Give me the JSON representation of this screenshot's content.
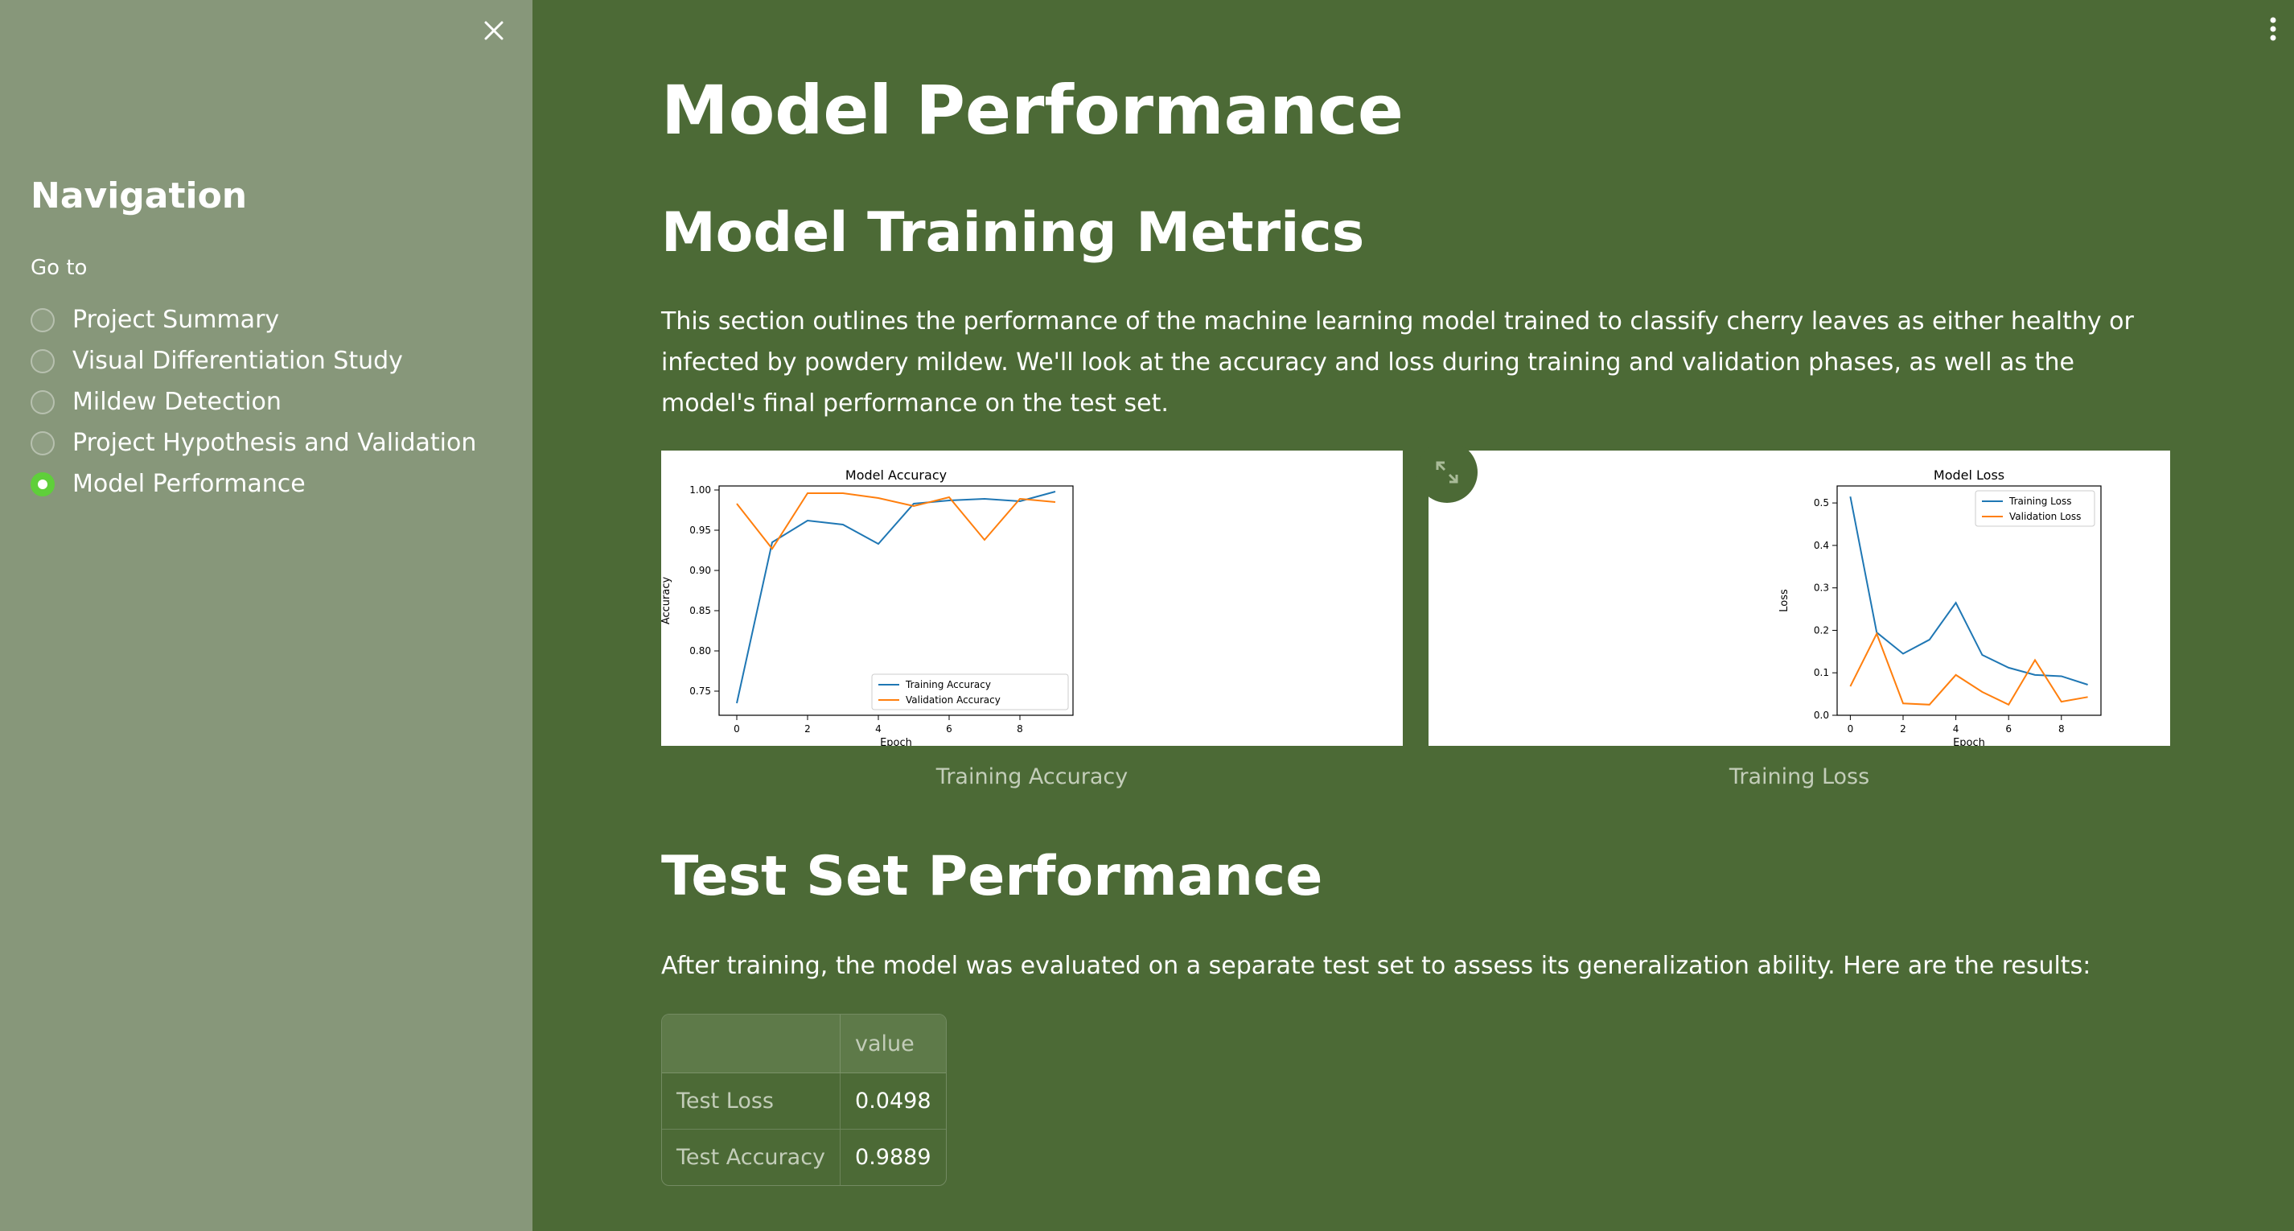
{
  "sidebar": {
    "title": "Navigation",
    "radio_label": "Go to",
    "items": [
      {
        "label": "Project Summary",
        "selected": false
      },
      {
        "label": "Visual Differentiation Study",
        "selected": false
      },
      {
        "label": "Mildew Detection",
        "selected": false
      },
      {
        "label": "Project Hypothesis and Validation",
        "selected": false
      },
      {
        "label": "Model Performance",
        "selected": true
      }
    ],
    "icons": {
      "close": "close-icon"
    }
  },
  "header": {
    "menu_icon": "kebab-menu-icon"
  },
  "main": {
    "title": "Model Performance",
    "training_section": {
      "heading": "Model Training Metrics",
      "description": "This section outlines the performance of the machine learning model trained to classify cherry leaves as either healthy or infected by powdery mildew. We'll look at the accuracy and loss during training and validation phases, as well as the model's final performance on the test set."
    },
    "images": [
      {
        "caption": "Training Accuracy"
      },
      {
        "caption": "Training Loss"
      }
    ],
    "test_section": {
      "heading": "Test Set Performance",
      "description": "After training, the model was evaluated on a separate test set to assess its generalization ability. Here are the results:"
    },
    "table": {
      "columns": [
        "",
        "value"
      ],
      "rows": [
        {
          "label": "Test Loss",
          "value": "0.0498"
        },
        {
          "label": "Test Accuracy",
          "value": "0.9889"
        }
      ]
    }
  },
  "colors": {
    "background": "#4c6a36",
    "sidebar": "#87977a",
    "radio_selected": "#5fcf3a",
    "training_line": "#1f77b4",
    "validation_line": "#ff7f0e"
  },
  "chart_data": [
    {
      "type": "line",
      "title": "Model Accuracy",
      "xlabel": "Epoch",
      "ylabel": "Accuracy",
      "x": [
        0,
        1,
        2,
        3,
        4,
        5,
        6,
        7,
        8,
        9
      ],
      "xlim": [
        -0.5,
        9.5
      ],
      "ylim": [
        0.72,
        1.005
      ],
      "xticks": [
        "0",
        "2",
        "4",
        "6",
        "8"
      ],
      "yticks": [
        "0.75",
        "0.80",
        "0.85",
        "0.90",
        "0.95",
        "1.00"
      ],
      "legend_position": "lower-right",
      "series": [
        {
          "name": "Training Accuracy",
          "values": [
            0.735,
            0.935,
            0.962,
            0.957,
            0.933,
            0.983,
            0.987,
            0.989,
            0.986,
            0.998
          ]
        },
        {
          "name": "Validation Accuracy",
          "values": [
            0.983,
            0.927,
            0.996,
            0.996,
            0.99,
            0.98,
            0.991,
            0.938,
            0.989,
            0.985
          ]
        }
      ]
    },
    {
      "type": "line",
      "title": "Model Loss",
      "xlabel": "Epoch",
      "ylabel": "Loss",
      "x": [
        0,
        1,
        2,
        3,
        4,
        5,
        6,
        7,
        8,
        9
      ],
      "xlim": [
        -0.5,
        9.5
      ],
      "ylim": [
        0.0,
        0.54
      ],
      "xticks": [
        "0",
        "2",
        "4",
        "6",
        "8"
      ],
      "yticks": [
        "0.0",
        "0.1",
        "0.2",
        "0.3",
        "0.4",
        "0.5"
      ],
      "legend_position": "upper-right",
      "series": [
        {
          "name": "Training Loss",
          "values": [
            0.515,
            0.195,
            0.145,
            0.178,
            0.265,
            0.142,
            0.112,
            0.095,
            0.092,
            0.072
          ]
        },
        {
          "name": "Validation Loss",
          "values": [
            0.068,
            0.192,
            0.028,
            0.025,
            0.095,
            0.055,
            0.025,
            0.13,
            0.032,
            0.043
          ]
        }
      ]
    }
  ]
}
